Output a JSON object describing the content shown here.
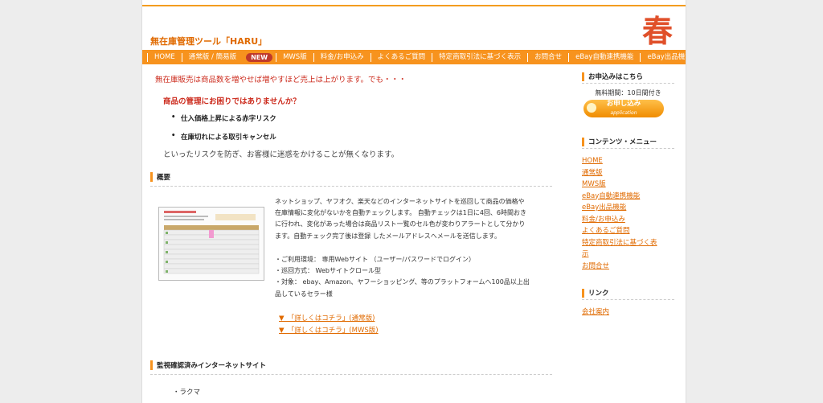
{
  "header": {
    "title": "無在庫管理ツール「HARU」",
    "logo_text": "春"
  },
  "nav": {
    "items": [
      "HOME",
      "通常版 / 簡易版",
      "MWS版",
      "料金/お申込み",
      "よくあるご質問",
      "特定商取引法に基づく表示",
      "お問合せ",
      "eBay自動連携機能",
      "eBay出品機能"
    ],
    "new_badge": "NEW"
  },
  "main": {
    "lead": "無在庫販売は商品数を増やせば増やすほど売上は上がります。でも・・・",
    "question": "商品の管理にお困りではありませんか？",
    "bullets": [
      "仕入価格上昇による赤字リスク",
      "在庫切れによる取引キャンセル"
    ],
    "closing": "といったリスクを防ぎ、お客様に迷惑をかけることが無くなります。",
    "overview_title": "概要",
    "overview_paragraphs": [
      "ネットショップ、ヤフオク、楽天などのインターネットサイトを巡回して商品の価格や",
      "在庫情報に変化がないかを自動チェックします。 自動チェックは1日に4回、6時間おき",
      "に行われ、変化があった場合は商品リスト一覧のセル色が変わりアラートとして分かり",
      "ます。自動チェック完了後は登録 したメールアドレスへメールを送信します。"
    ],
    "specs": [
      "・ご利用環境： 専用Webサイト （ユーザー/パスワードでログイン）",
      "・巡回方式： Webサイトクロール型",
      "・対象： ebay、Amazon、ヤフーショッピング、等のプラットフォームへ100品以上出",
      "品しているセラー様"
    ],
    "detail_links": [
      "▼　「詳しくはコチラ」(通常版)",
      "▼　「詳しくはコチラ」(MWS版)"
    ],
    "sites_title": "監視確認済みインターネットサイト",
    "sites": [
      "・ラクマ"
    ]
  },
  "sidebar": {
    "apply_title": "お申込みはこちら",
    "trial": "無料期間：10日間付き",
    "apply_button": "お申し込み",
    "apply_button_sub": "application",
    "menu_title": "コンテンツ・メニュー",
    "menu": [
      "HOME",
      "通常版",
      "MWS版",
      "eBay自動連携機能",
      "eBay出品機能",
      "料金/お申込み",
      "よくあるご質問",
      "特定商取引法に基づく表",
      "示",
      "お問合せ"
    ],
    "link_title": "リンク",
    "links": [
      "会社案内"
    ]
  },
  "colors": {
    "accent": "#f7931e",
    "brand": "#e06a00",
    "red_text": "#cc2b1d"
  }
}
